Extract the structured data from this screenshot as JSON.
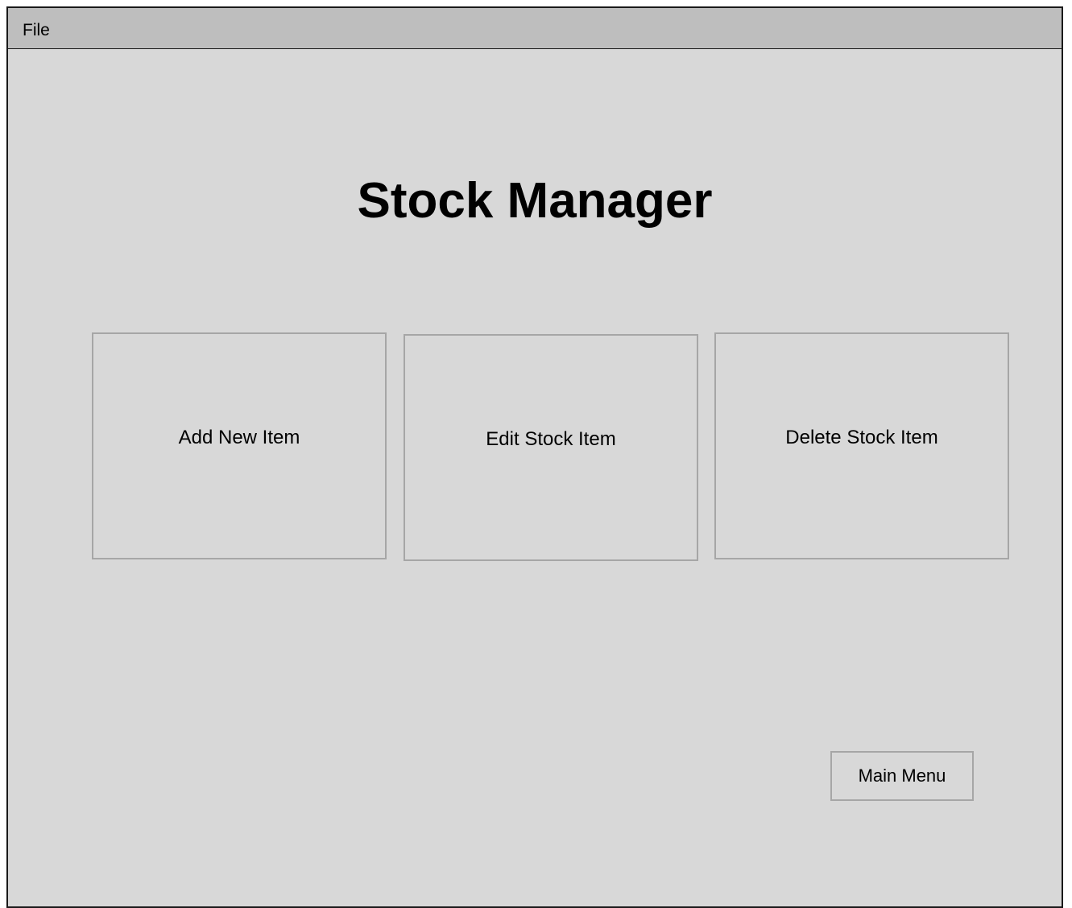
{
  "menubar": {
    "items": [
      {
        "label": "File"
      }
    ]
  },
  "main": {
    "title": "Stock Manager",
    "tiles": [
      {
        "label": "Add New Item"
      },
      {
        "label": "Edit Stock Item"
      },
      {
        "label": "Delete Stock Item"
      }
    ],
    "main_menu_label": "Main Menu"
  },
  "colors": {
    "window_background": "#d8d8d8",
    "menubar_background": "#bebebe",
    "tile_border": "#a6a6a6",
    "window_border": "#1a1a1a"
  }
}
